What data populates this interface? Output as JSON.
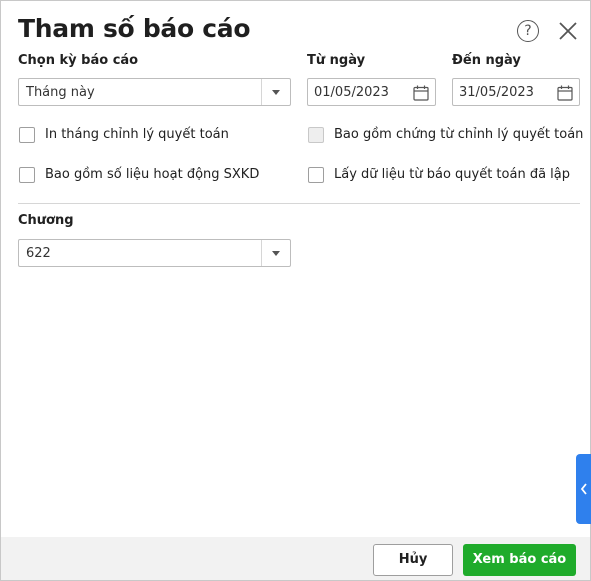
{
  "dialog": {
    "title": "Tham số báo cáo",
    "help_icon_glyph": "?"
  },
  "period": {
    "label": "Chọn kỳ báo cáo",
    "value": "Tháng này"
  },
  "from_date": {
    "label": "Từ ngày",
    "value": "01/05/2023"
  },
  "to_date": {
    "label": "Đến ngày",
    "value": "31/05/2023"
  },
  "options": [
    {
      "label": "In tháng chỉnh lý quyết toán",
      "checked": false,
      "enabled": true
    },
    {
      "label": "Bao gồm chứng từ chỉnh lý quyết toán",
      "checked": false,
      "enabled": false
    },
    {
      "label": "Bao gồm số liệu hoạt động SXKD",
      "checked": false,
      "enabled": true
    },
    {
      "label": "Lấy dữ liệu từ báo quyết toán đã lập",
      "checked": false,
      "enabled": true
    }
  ],
  "chapter": {
    "label": "Chương",
    "value": "622"
  },
  "footer": {
    "cancel_label": "Hủy",
    "submit_label": "Xem báo cáo"
  },
  "colors": {
    "primary_button": "#1fab2b",
    "side_tab": "#2f80ed"
  }
}
